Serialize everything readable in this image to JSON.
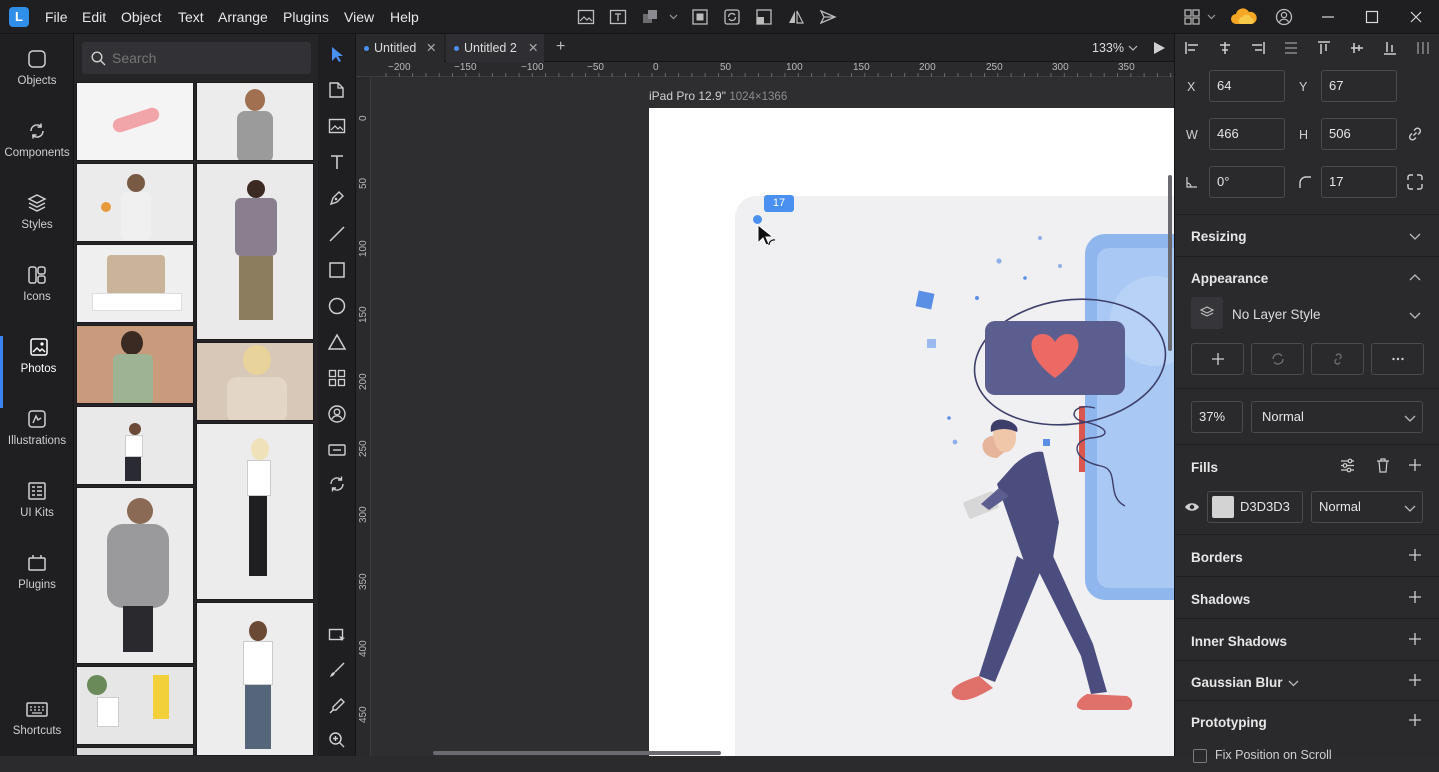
{
  "app": {
    "logo_letter": "L",
    "accent": "#3b82f6"
  },
  "menu": [
    "File",
    "Edit",
    "Object",
    "Text",
    "Arrange",
    "Plugins",
    "View",
    "Help"
  ],
  "left_nav": [
    {
      "label": "Objects",
      "icon": "objects-icon"
    },
    {
      "label": "Components",
      "icon": "components-icon"
    },
    {
      "label": "Styles",
      "icon": "styles-icon"
    },
    {
      "label": "Icons",
      "icon": "icons-icon"
    },
    {
      "label": "Photos",
      "icon": "photos-icon",
      "active": true
    },
    {
      "label": "Illustrations",
      "icon": "illustrations-icon"
    },
    {
      "label": "UI Kits",
      "icon": "ui-kits-icon"
    },
    {
      "label": "Plugins",
      "icon": "plugins-icon"
    },
    {
      "label": "Shortcuts",
      "icon": "keyboard-icon"
    }
  ],
  "search": {
    "placeholder": "Search"
  },
  "tabs": [
    {
      "label": "Untitled"
    },
    {
      "label": "Untitled 2"
    }
  ],
  "zoom": "133%",
  "ruler_h": [
    "−200",
    "−150",
    "−100",
    "−50",
    "0",
    "50",
    "100",
    "150",
    "200",
    "250",
    "300",
    "350"
  ],
  "ruler_v": [
    "0",
    "50",
    "100",
    "150",
    "200",
    "250",
    "300",
    "350",
    "400",
    "450"
  ],
  "artboard": {
    "name": "iPad Pro 12.9\"",
    "size": "1024×1366"
  },
  "radius_badge": "17",
  "props": {
    "x_label": "X",
    "x": "64",
    "y_label": "Y",
    "y": "67",
    "w_label": "W",
    "w": "466",
    "h_label": "H",
    "h": "506",
    "rotation": "0°",
    "radius": "17"
  },
  "sections": {
    "resizing": "Resizing",
    "appearance": "Appearance",
    "layer_style": "No Layer Style",
    "opacity": "37%",
    "blend": "Normal",
    "fills": "Fills",
    "fill_color": "D3D3D3",
    "fill_swatch": "#d3d3d3",
    "fill_blend": "Normal",
    "borders": "Borders",
    "shadows": "Shadows",
    "inner_shadows": "Inner Shadows",
    "gaussian_blur": "Gaussian Blur",
    "prototyping": "Prototyping",
    "fix_position": "Fix Position on Scroll"
  }
}
